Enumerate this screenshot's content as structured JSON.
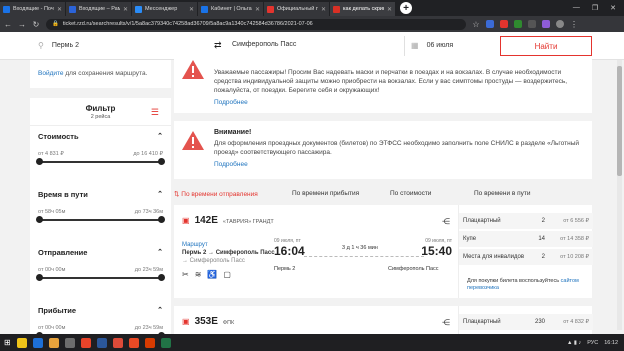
{
  "browser": {
    "tabs": [
      {
        "title": "Входящие - Почта Ма",
        "color": "#1a73e8",
        "active": false
      },
      {
        "title": "Входящие – Рамблер",
        "color": "#2b63d8",
        "active": false
      },
      {
        "title": "Мессенджер",
        "color": "#2a8cf7",
        "active": false
      },
      {
        "title": "Кабинет | Ольга Капан",
        "color": "#1a73e8",
        "active": false
      },
      {
        "title": "Официальный портал",
        "color": "#e4342e",
        "active": false
      },
      {
        "title": "как делать скрин с экр",
        "color": "#d93025",
        "active": true
      }
    ],
    "url": "ticket.rzd.ru/searchresults/v/1/5a8ac379340c74258ad36709/5a8ac9a1340c742584d36786/2021-07-06"
  },
  "search": {
    "from": "Пермь 2",
    "to": "Симферополь Пасс",
    "date": "06 июля",
    "button": "Найти"
  },
  "sidebar": {
    "login_link": "Войдите",
    "login_text": " для сохранения маршрута.",
    "filter_title": "Фильтр",
    "filter_sub": "2 рейса",
    "sections": [
      {
        "title": "Стоимость",
        "from": "от 4 831 ₽",
        "to": "до 16 410 ₽"
      },
      {
        "title": "Время в пути",
        "from": "от 58ч 05м",
        "to": "до 73ч 36м"
      },
      {
        "title": "Отправление",
        "from": "от 00ч 00м",
        "to": "до 23ч 59м"
      },
      {
        "title": "Прибытие",
        "from": "от 00ч 00м",
        "to": "до 23ч 59м"
      }
    ]
  },
  "notices": [
    {
      "title": "",
      "text": "Уважаемые пассажиры! Просим Вас надевать маски и перчатки в поездах и на вокзалах. В случае необходимости средства индивидуальной защиты можно приобрести на вокзалах. Если у вас симптомы простуды — воздержитесь, пожалуйста, от поездки. Берегите себя и окружающих!",
      "more": "Подробнее"
    },
    {
      "title": "Внимание!",
      "text": "Для оформления проездных документов (билетов) по ЭТФСС необходимо заполнить поле СНИЛС в разделе «Льготный проезд» соответствующего пассажира.",
      "more": "Подробнее"
    }
  ],
  "sort": {
    "departure": "По времени отправления",
    "arrival": "По времени прибытия",
    "price": "По стоимости",
    "duration": "По времени в пути"
  },
  "trains": [
    {
      "number": "142Е",
      "name": "«ТАВРИЯ» ГРАНДТ",
      "route_link": "Маршрут",
      "route": "Пермь 2 → Симферополь Пасс",
      "route_sub": "→ Симферополь Пасс",
      "route_from": "Пермь 2",
      "dep_date": "09 июля, пт",
      "dep_time": "16:04",
      "duration": "3 д 1 ч 36 мин",
      "arr_date": "09 июля, пт",
      "arr_time": "15:40",
      "dep_station": "Пермь 2",
      "arr_station": "Симферополь Пасс",
      "classes": [
        {
          "name": "Плацкартный",
          "count": "2",
          "price": "от 6 556 ₽"
        },
        {
          "name": "Купе",
          "count": "14",
          "price": "от 14 358 ₽"
        },
        {
          "name": "Места для инвалидов",
          "count": "2",
          "price": "от 10 208 ₽"
        }
      ],
      "buy_note": "Для покупки билета воспользуйтесь ",
      "buy_link": "сайтом перевозчика"
    },
    {
      "number": "353Е",
      "name": "ФПК",
      "classes": [
        {
          "name": "Плацкартный",
          "count": "230",
          "price": "от 4 832 ₽"
        }
      ]
    }
  ],
  "taskbar": {
    "lang": "РУС",
    "time": "16:12"
  }
}
